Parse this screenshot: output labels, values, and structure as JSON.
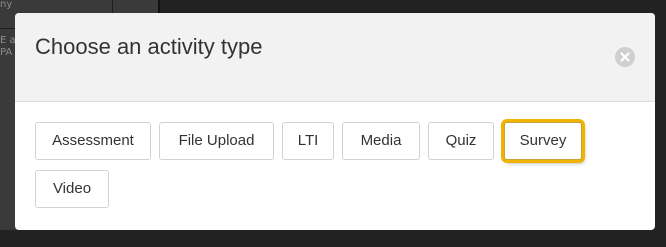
{
  "background": {
    "fragment_top": "ny",
    "fragment_left": "E a",
    "fragment_left_2": "PA"
  },
  "modal": {
    "title": "Choose an activity type",
    "close_icon": "close-circle-icon"
  },
  "activity_types": [
    {
      "label": "Assessment"
    },
    {
      "label": "File Upload"
    },
    {
      "label": "LTI"
    },
    {
      "label": "Media"
    },
    {
      "label": "Quiz"
    },
    {
      "label": "Survey",
      "highlighted": true
    },
    {
      "label": "Video"
    }
  ],
  "colors": {
    "highlight": "#f0b400",
    "header_bg": "#f2f2f2",
    "overlay": "#222222"
  }
}
